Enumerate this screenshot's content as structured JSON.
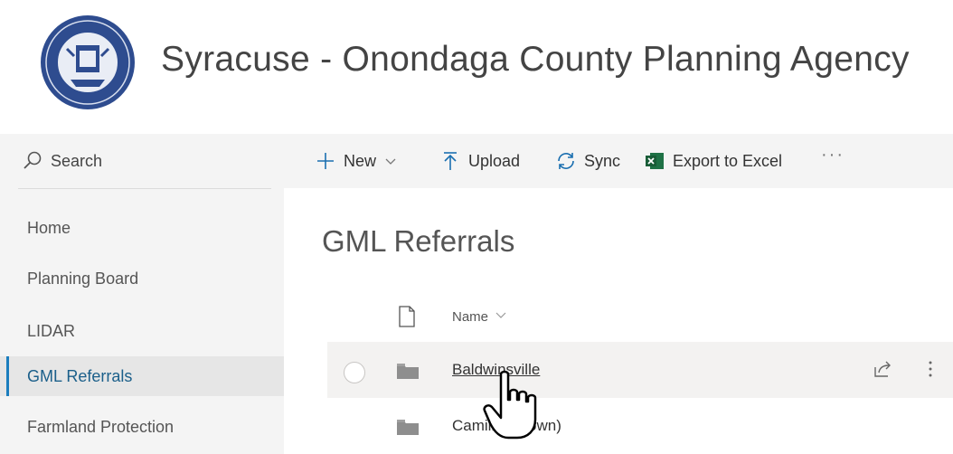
{
  "site": {
    "title": "Syracuse - Onondaga County Planning Agency",
    "logo_icon": "county-seal-logo",
    "colors": {
      "seal_blue": "#2e4c8f",
      "accent": "#1b7dbe",
      "nav_bg": "#f4f4f4"
    }
  },
  "nav": {
    "search_label": "Search",
    "items": [
      {
        "label": "Home",
        "active": false
      },
      {
        "label": "Planning Board",
        "active": false
      },
      {
        "label": "LIDAR",
        "active": false
      },
      {
        "label": "GML Referrals",
        "active": true
      },
      {
        "label": "Farmland Protection",
        "active": false
      }
    ]
  },
  "commandbar": {
    "new_label": "New",
    "upload_label": "Upload",
    "sync_label": "Sync",
    "export_label": "Export to Excel",
    "more_label": "···"
  },
  "library": {
    "title": "GML Referrals",
    "columns": {
      "name": "Name"
    },
    "rows": [
      {
        "name": "Baldwinsville",
        "selected": true
      },
      {
        "name": "Camillus (Town)",
        "selected": false
      }
    ]
  }
}
